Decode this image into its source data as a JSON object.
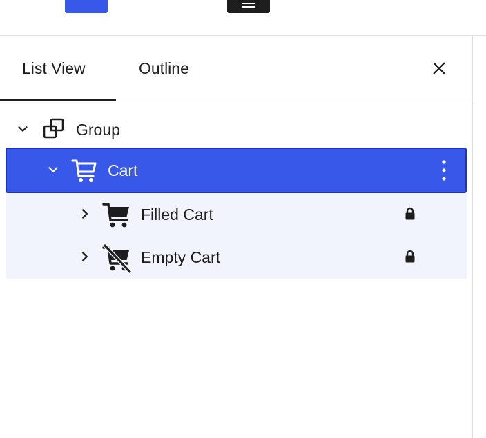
{
  "tabs": [
    {
      "label": "List View",
      "active": true
    },
    {
      "label": "Outline",
      "active": false
    }
  ],
  "close": {
    "icon": "close-icon"
  },
  "tree": {
    "group": {
      "label": "Group",
      "icon": "group-icon",
      "expanded": true
    },
    "cart": {
      "label": "Cart",
      "icon": "cart-icon",
      "expanded": true,
      "selected": true,
      "menu_icon": "more-vertical-icon"
    },
    "children": [
      {
        "label": "Filled Cart",
        "icon": "filled-cart-icon",
        "locked": true,
        "lock_icon": "lock-icon"
      },
      {
        "label": "Empty Cart",
        "icon": "empty-cart-icon",
        "locked": true,
        "lock_icon": "lock-icon"
      }
    ]
  },
  "colors": {
    "accent": "#3858e9",
    "accent_border": "#1d35b4",
    "child_background": "#f2f4fd",
    "text": "#1e1e1e"
  }
}
